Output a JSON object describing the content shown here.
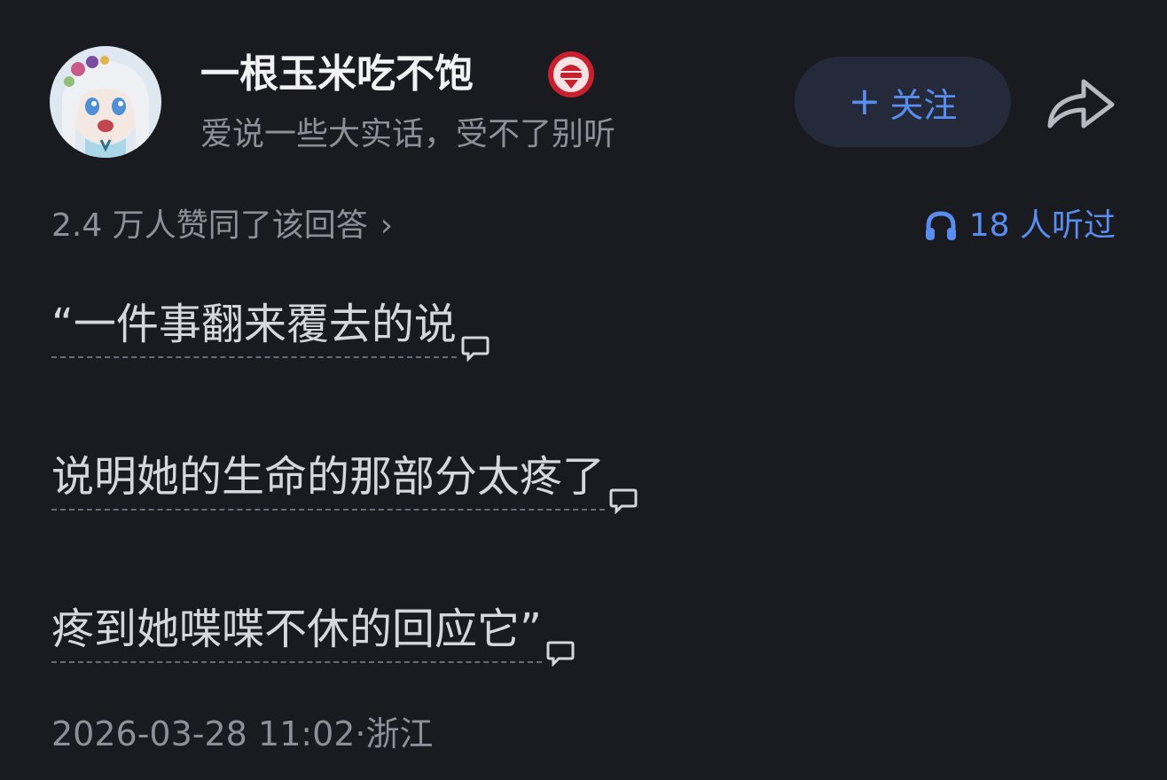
{
  "author": {
    "name": "一根玉米吃不饱",
    "bio": "爱说一些大实话，受不了别听",
    "badge_icon": "red-badge-icon"
  },
  "actions": {
    "follow_plus": "+",
    "follow_label": "关注",
    "share_icon": "share-arrow-icon"
  },
  "stats": {
    "likes_text": "2.4 万人赞同了该回答",
    "likes_chevron": "›",
    "listen_text": "18 人听过",
    "listen_icon": "headphones-icon"
  },
  "content": {
    "lines": [
      "“一件事翻来覆去的说",
      "说明她的生命的那部分太疼了",
      "疼到她喋喋不休的回应它”"
    ]
  },
  "meta": {
    "date_location": "2026-03-28 11:02·浙江"
  },
  "colors": {
    "background": "#1a1b20",
    "accent_blue": "#5a8df0",
    "muted_text": "#8e9099",
    "body_text": "#d6d7dc"
  }
}
